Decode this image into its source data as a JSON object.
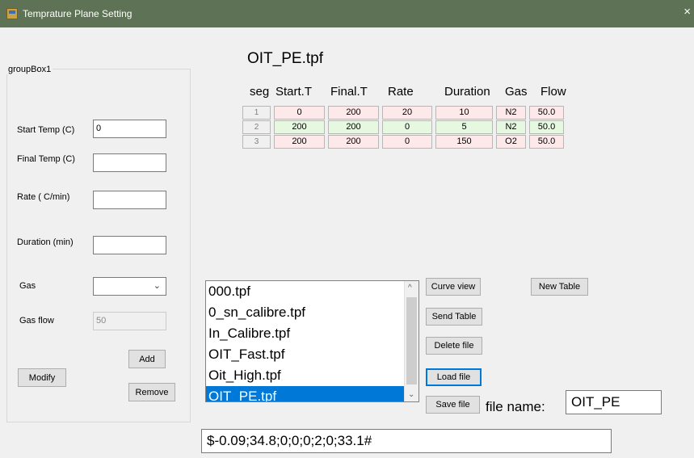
{
  "window": {
    "title": "Temprature Plane Setting",
    "close_glyph": "×"
  },
  "group_box": {
    "label": "groupBox1",
    "start_temp_label": "Start Temp (C)",
    "start_temp_value": "0",
    "final_temp_label": "Final Temp (C)",
    "final_temp_value": "",
    "rate_label": "Rate ( C/min)",
    "rate_value": "",
    "duration_label": "Duration (min)",
    "duration_value": "",
    "gas_label": "Gas",
    "gas_value": "",
    "gas_flow_label": "Gas flow",
    "gas_flow_value": "50",
    "add_label": "Add",
    "modify_label": "Modify",
    "remove_label": "Remove"
  },
  "file_heading": "OIT_PE.tpf",
  "table": {
    "headers": [
      "seg",
      "Start.T",
      "Final.T",
      "Rate",
      "Duration",
      "Gas",
      "Flow"
    ],
    "rows": [
      [
        "1",
        "0",
        "200",
        "20",
        "10",
        "N2",
        "50.0"
      ],
      [
        "2",
        "200",
        "200",
        "0",
        "5",
        "N2",
        "50.0"
      ],
      [
        "3",
        "200",
        "200",
        "0",
        "150",
        "O2",
        "50.0"
      ]
    ]
  },
  "file_list": {
    "items": [
      "000.tpf",
      "0_sn_calibre.tpf",
      "In_Calibre.tpf",
      "OIT_Fast.tpf",
      "Oit_High.tpf",
      "OIT_PE.tpf"
    ],
    "selected": "OIT_PE.tpf"
  },
  "buttons": {
    "curve_view": "Curve view",
    "new_table": "New Table",
    "send_table": "Send Table",
    "delete_file": "Delete file",
    "load_file": "Load file",
    "save_file": "Save file"
  },
  "file_name": {
    "label": "file name:",
    "value": "OIT_PE"
  },
  "command_text": "$-0.09;34.8;0;0;0;2;0;33.1#",
  "colors": {
    "titlebar": "#5e7355",
    "selection": "#0078d7",
    "row_pink": "#fde9e9",
    "row_green": "#e6f8e0"
  }
}
